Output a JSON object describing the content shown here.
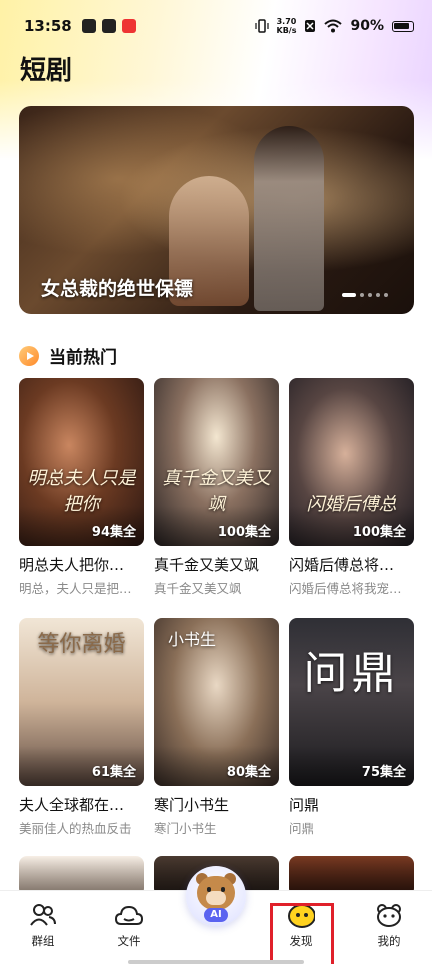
{
  "status_bar": {
    "time": "13:58",
    "net_speed_value": "3.70",
    "net_speed_unit": "KB/s",
    "battery": "90%"
  },
  "page_title": "短剧",
  "banner": {
    "caption": "女总裁的绝世保镖"
  },
  "section": {
    "title": "当前热门"
  },
  "cards": [
    {
      "title": "明总夫人把你…",
      "subtitle": "明总，夫人只是把…",
      "episodes": "94集全",
      "poster_text": "明总夫人只是把你"
    },
    {
      "title": "真千金又美又飒",
      "subtitle": "真千金又美又飒",
      "episodes": "100集全",
      "poster_text": "真千金又美又飒"
    },
    {
      "title": "闪婚后傅总将…",
      "subtitle": "闪婚后傅总将我宠…",
      "episodes": "100集全",
      "poster_text": "闪婚后傅总"
    },
    {
      "title": "夫人全球都在…",
      "subtitle": "美丽佳人的热血反击",
      "episodes": "61集全",
      "poster_text": "等你离婚"
    },
    {
      "title": "寒门小书生",
      "subtitle": "寒门小书生",
      "episodes": "80集全",
      "poster_text": "小书生"
    },
    {
      "title": "问鼎",
      "subtitle": "问鼎",
      "episodes": "75集全",
      "poster_text": "问鼎"
    }
  ],
  "bottom_nav": {
    "items": [
      {
        "label": "群组",
        "icon": "group-icon"
      },
      {
        "label": "文件",
        "icon": "cloud-icon"
      },
      {
        "label": "AI",
        "icon": "ai-bear-icon"
      },
      {
        "label": "发现",
        "icon": "discover-icon",
        "active": true
      },
      {
        "label": "我的",
        "icon": "profile-icon"
      }
    ]
  }
}
